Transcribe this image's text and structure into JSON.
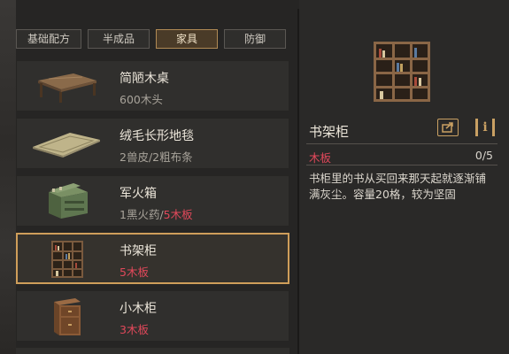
{
  "tabs": [
    {
      "label": "基础配方",
      "active": false
    },
    {
      "label": "半成品",
      "active": false
    },
    {
      "label": "家具",
      "active": true
    },
    {
      "label": "防御",
      "active": false
    }
  ],
  "items": [
    {
      "name": "简陋木桌",
      "cost_plain": "600木头",
      "cost_red": "",
      "icon": "wooden-table-icon",
      "selected": false
    },
    {
      "name": "绒毛长形地毯",
      "cost_plain": "2兽皮/2粗布条",
      "cost_red": "",
      "icon": "rug-icon",
      "selected": false
    },
    {
      "name": "军火箱",
      "cost_plain": "1黑火药/",
      "cost_red": "5木板",
      "icon": "ammo-crate-icon",
      "selected": false
    },
    {
      "name": "书架柜",
      "cost_plain": "",
      "cost_red": "5木板",
      "icon": "bookshelf-icon",
      "selected": true
    },
    {
      "name": "小木柜",
      "cost_plain": "",
      "cost_red": "3木板",
      "icon": "small-cabinet-icon",
      "selected": false
    }
  ],
  "detail": {
    "title": "书架柜",
    "icon": "bookshelf-icon",
    "material": {
      "name": "木板",
      "count": "0/5"
    },
    "description": "书柜里的书从买回来那天起就逐渐铺满灰尘。容量20格，较为坚固",
    "share_icon": "share-icon",
    "info_label": "i"
  },
  "colors": {
    "accent": "#cf9e5a",
    "insufficient": "#e0485a",
    "background": "#262524"
  }
}
